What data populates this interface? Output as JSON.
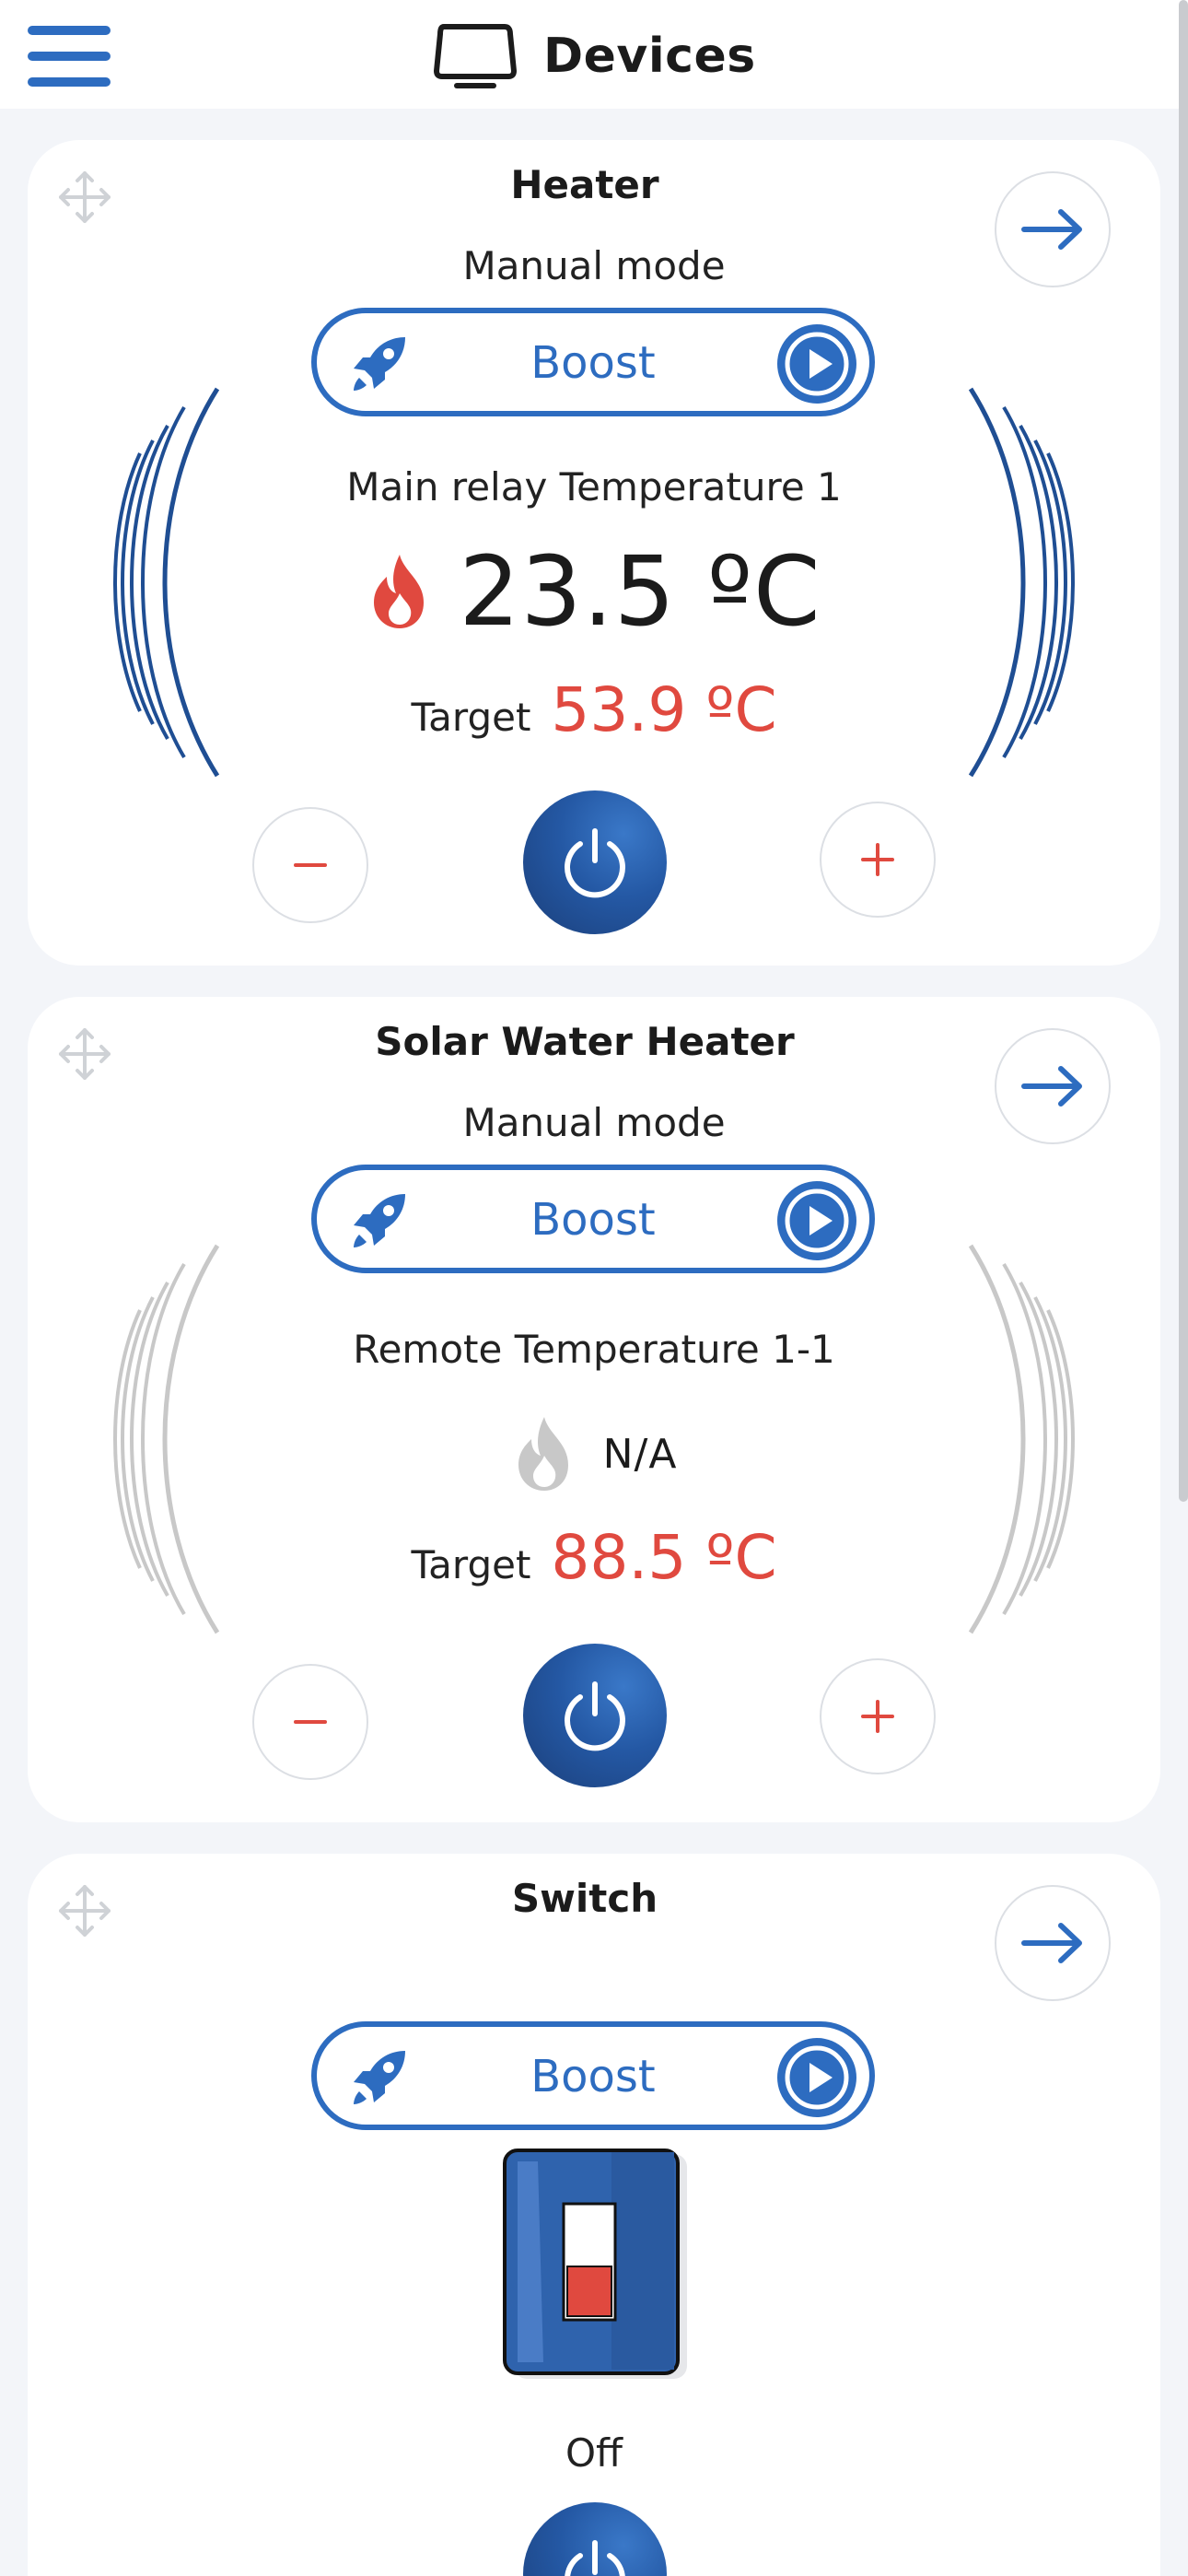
{
  "header": {
    "title": "Devices",
    "menu_icon": "hamburger-menu-icon",
    "title_icon": "device-monitor-icon"
  },
  "colors": {
    "accent": "#2d6cc0",
    "danger": "#e0493f",
    "inactive": "#c8c8c8",
    "card": "#ffffff",
    "background": "#f3f5f9"
  },
  "cards": [
    {
      "title": "Heater",
      "mode": "Manual mode",
      "boost_label": "Boost",
      "sensor_label": "Main relay Temperature 1",
      "temperature": "23.5 ºC",
      "flame_state": "active",
      "target_label": "Target",
      "target_value": "53.9 ºC",
      "minus_label": "−",
      "plus_label": "+"
    },
    {
      "title": "Solar Water Heater",
      "mode": "Manual mode",
      "boost_label": "Boost",
      "sensor_label": "Remote Temperature 1-1",
      "temperature": "N/A",
      "flame_state": "inactive",
      "target_label": "Target",
      "target_value": "88.5 ºC",
      "minus_label": "−",
      "plus_label": "+"
    },
    {
      "title": "Switch",
      "boost_label": "Boost",
      "switch_state": "Off"
    }
  ]
}
